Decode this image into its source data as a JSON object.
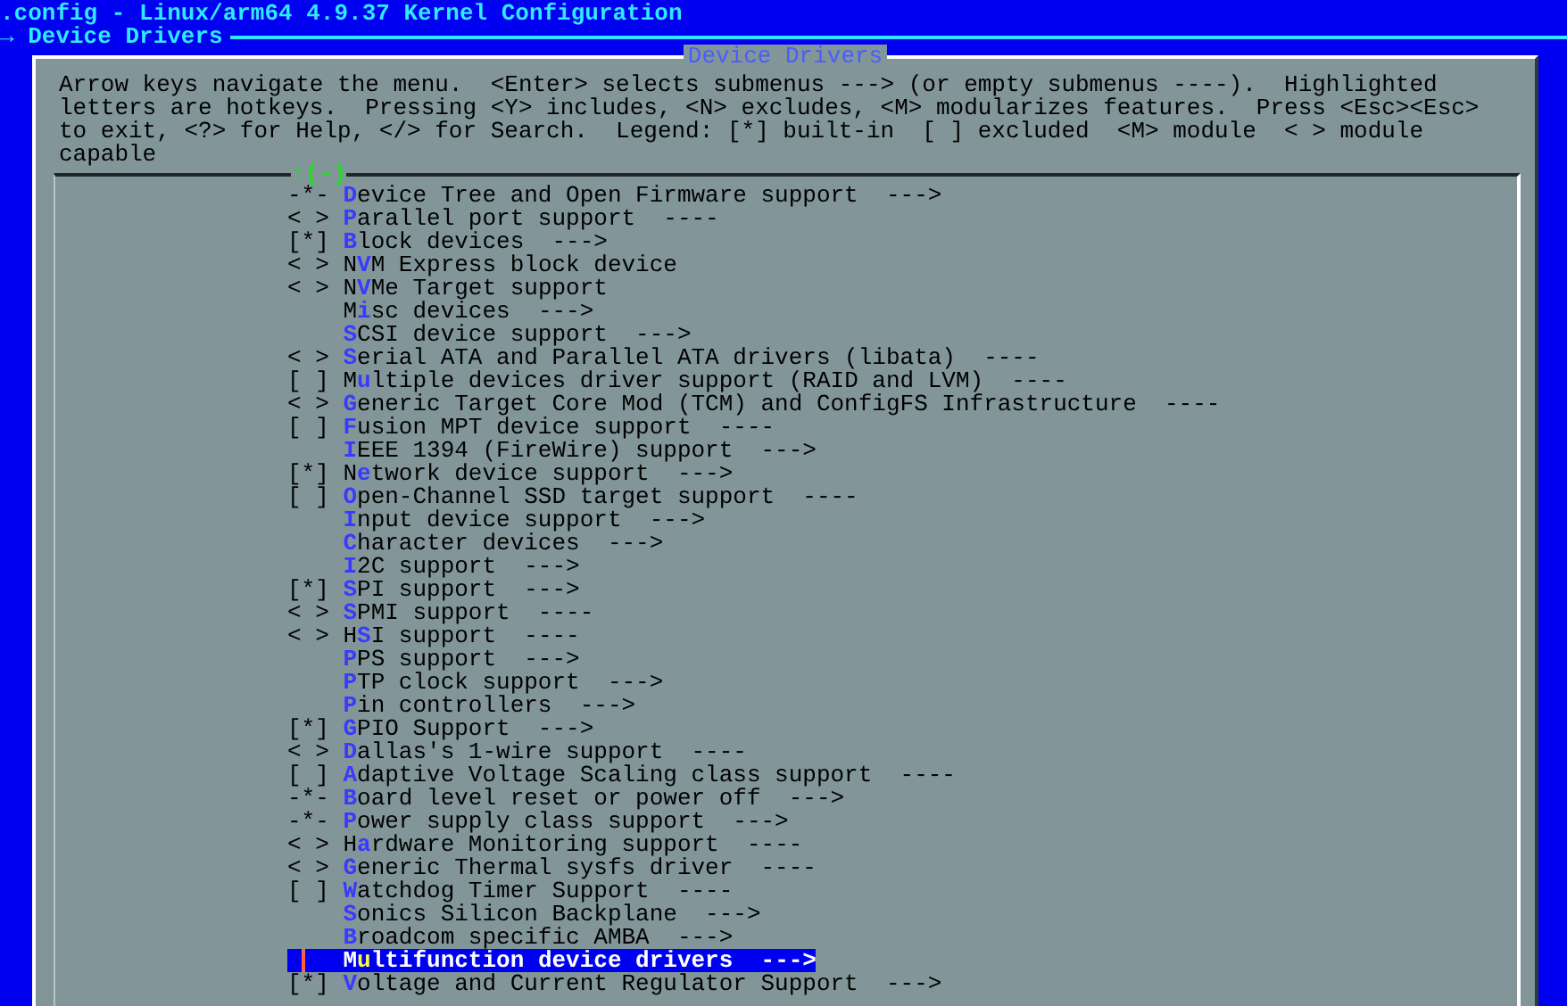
{
  "window": {
    "title": ".config - Linux/arm64 4.9.37 Kernel Configuration"
  },
  "breadcrumb": {
    "arrow": "→",
    "label": "Device Drivers"
  },
  "dialog": {
    "title": "Device Drivers",
    "help": "Arrow keys navigate the menu.  <Enter> selects submenus ---> (or empty submenus ----).  Highlighted\nletters are hotkeys.  Pressing <Y> includes, <N> excludes, <M> modularizes features.  Press <Esc><Esc>\nto exit, <?> for Help, </> for Search.  Legend: [*] built-in  [ ] excluded  <M> module  < > module\ncapable",
    "scroll_indicator": "↑(-)",
    "items": [
      {
        "prefix": "-*-",
        "hotkey": "D",
        "rest": "evice Tree and Open Firmware support  --->",
        "selected": false
      },
      {
        "prefix": "< >",
        "hotkey": "P",
        "rest": "arallel port support  ----",
        "selected": false
      },
      {
        "prefix": "[*]",
        "hotkey": "B",
        "rest": "lock devices  --->",
        "selected": false
      },
      {
        "prefix": "< >",
        "lead": "N",
        "hotkey": "V",
        "rest": "M Express block device",
        "selected": false
      },
      {
        "prefix": "< >",
        "lead": "N",
        "hotkey": "V",
        "rest": "Me Target support",
        "selected": false
      },
      {
        "lead": "M",
        "hotkey": "i",
        "rest": "sc devices  --->",
        "selected": false
      },
      {
        "hotkey": "S",
        "rest": "CSI device support  --->",
        "selected": false
      },
      {
        "prefix": "< >",
        "hotkey": "S",
        "rest": "erial ATA and Parallel ATA drivers (libata)  ----",
        "selected": false
      },
      {
        "prefix": "[ ]",
        "lead": "M",
        "hotkey": "u",
        "rest": "ltiple devices driver support (RAID and LVM)  ----",
        "selected": false
      },
      {
        "prefix": "< >",
        "hotkey": "G",
        "rest": "eneric Target Core Mod (TCM) and ConfigFS Infrastructure  ----",
        "selected": false
      },
      {
        "prefix": "[ ]",
        "hotkey": "F",
        "rest": "usion MPT device support  ----",
        "selected": false
      },
      {
        "hotkey": "I",
        "rest": "EEE 1394 (FireWire) support  --->",
        "selected": false
      },
      {
        "prefix": "[*]",
        "lead": "N",
        "hotkey": "e",
        "rest": "twork device support  --->",
        "selected": false
      },
      {
        "prefix": "[ ]",
        "hotkey": "O",
        "rest": "pen-Channel SSD target support  ----",
        "selected": false
      },
      {
        "hotkey": "I",
        "rest": "nput device support  --->",
        "selected": false
      },
      {
        "hotkey": "C",
        "rest": "haracter devices  --->",
        "selected": false
      },
      {
        "hotkey": "I",
        "rest": "2C support  --->",
        "selected": false
      },
      {
        "prefix": "[*]",
        "hotkey": "S",
        "rest": "PI support  --->",
        "selected": false
      },
      {
        "prefix": "< >",
        "hotkey": "S",
        "rest": "PMI support  ----",
        "selected": false
      },
      {
        "prefix": "< >",
        "lead": "H",
        "hotkey": "S",
        "rest": "I support  ----",
        "selected": false
      },
      {
        "hotkey": "P",
        "rest": "PS support  --->",
        "selected": false
      },
      {
        "hotkey": "P",
        "rest": "TP clock support  --->",
        "selected": false
      },
      {
        "hotkey": "P",
        "rest": "in controllers  --->",
        "selected": false
      },
      {
        "prefix": "[*]",
        "hotkey": "G",
        "rest": "PIO Support  --->",
        "selected": false
      },
      {
        "prefix": "< >",
        "hotkey": "D",
        "rest": "allas's 1-wire support  ----",
        "selected": false
      },
      {
        "prefix": "[ ]",
        "hotkey": "A",
        "rest": "daptive Voltage Scaling class support  ----",
        "selected": false
      },
      {
        "prefix": "-*-",
        "hotkey": "B",
        "rest": "oard level reset or power off  --->",
        "selected": false
      },
      {
        "prefix": "-*-",
        "hotkey": "P",
        "rest": "ower supply class support  --->",
        "selected": false
      },
      {
        "prefix": "< >",
        "lead": "H",
        "hotkey": "a",
        "rest": "rdware Monitoring support  ----",
        "selected": false
      },
      {
        "prefix": "< >",
        "hotkey": "G",
        "rest": "eneric Thermal sysfs driver  ----",
        "selected": false
      },
      {
        "prefix": "[ ]",
        "hotkey": "W",
        "rest": "atchdog Timer Support  ----",
        "selected": false
      },
      {
        "hotkey": "S",
        "rest": "onics Silicon Backplane  --->",
        "selected": false
      },
      {
        "hotkey": "B",
        "rest": "roadcom specific AMBA  --->",
        "selected": false
      },
      {
        "lead": "M",
        "hotkey": "u",
        "rest": "ltifunction device drivers  --->",
        "selected": true
      },
      {
        "prefix": "[*]",
        "hotkey": "V",
        "rest": "oltage and Current Regulator Support  --->",
        "selected": false
      }
    ]
  }
}
